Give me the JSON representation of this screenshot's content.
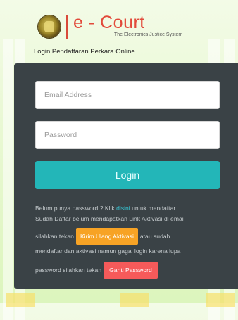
{
  "header": {
    "brand_prefix": "e",
    "brand_separator": " - ",
    "brand_name": "Court",
    "tagline": "The Electronics Justice System",
    "subtitle": "Login Pendaftaran Perkara Online"
  },
  "form": {
    "email_placeholder": "Email Address",
    "password_placeholder": "Password",
    "login_label": "Login"
  },
  "info": {
    "line1_prefix": "Belum punya password ? Klik ",
    "line1_link": "disini",
    "line1_suffix": " untuk mendaftar.",
    "line2": "Sudah Daftar belum mendapatkan Link Aktivasi di email",
    "line3_prefix": "silahkan tekan",
    "resend_button": "Kirim Ulang Aktivasi",
    "line3_suffix": "atau sudah",
    "line4": "mendaftar dan aktivasi namun gagal login karena lupa",
    "line5_prefix": "password silahkan tekan",
    "change_password_button": "Ganti Password"
  },
  "colors": {
    "brand": "#e24a3b",
    "card": "#3a4246",
    "login_button": "#23b6b8",
    "resend_button": "#f7a325",
    "change_password_button": "#f65a5a"
  }
}
